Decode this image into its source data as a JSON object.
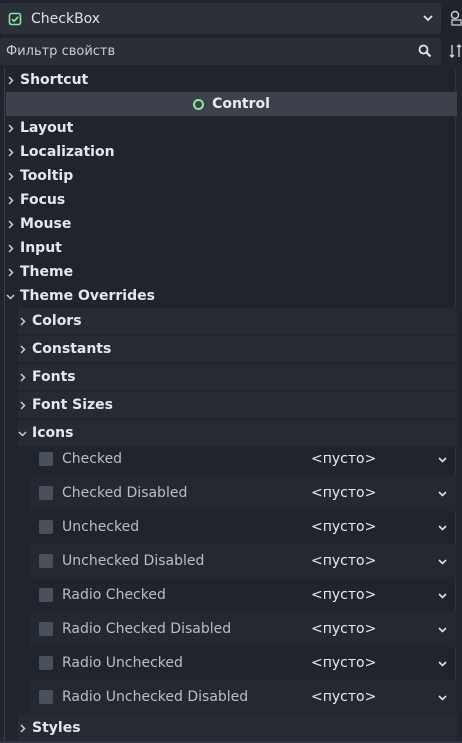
{
  "node_selector": {
    "name": "CheckBox",
    "icon": "checkbox-icon",
    "accent": "#8ee4a0"
  },
  "filter": {
    "placeholder": "Фильтр свойств",
    "icon": "search-icon"
  },
  "sections": {
    "shortcut": "Shortcut",
    "control_header": "Control",
    "layout": "Layout",
    "localization": "Localization",
    "tooltip": "Tooltip",
    "focus": "Focus",
    "mouse": "Mouse",
    "input": "Input",
    "theme": "Theme",
    "theme_overrides": "Theme Overrides"
  },
  "theme_overrides": {
    "colors": "Colors",
    "constants": "Constants",
    "fonts": "Fonts",
    "font_sizes": "Font Sizes",
    "icons": "Icons",
    "styles": "Styles"
  },
  "icon_properties": [
    {
      "name": "Checked",
      "value": "<пусто>"
    },
    {
      "name": "Checked Disabled",
      "value": "<пусто>"
    },
    {
      "name": "Unchecked",
      "value": "<пусто>"
    },
    {
      "name": "Unchecked Disabled",
      "value": "<пусто>"
    },
    {
      "name": "Radio Checked",
      "value": "<пусто>"
    },
    {
      "name": "Radio Checked Disabled",
      "value": "<пусто>"
    },
    {
      "name": "Radio Unchecked",
      "value": "<пусто>"
    },
    {
      "name": "Radio Unchecked Disabled",
      "value": "<пусто>"
    }
  ]
}
